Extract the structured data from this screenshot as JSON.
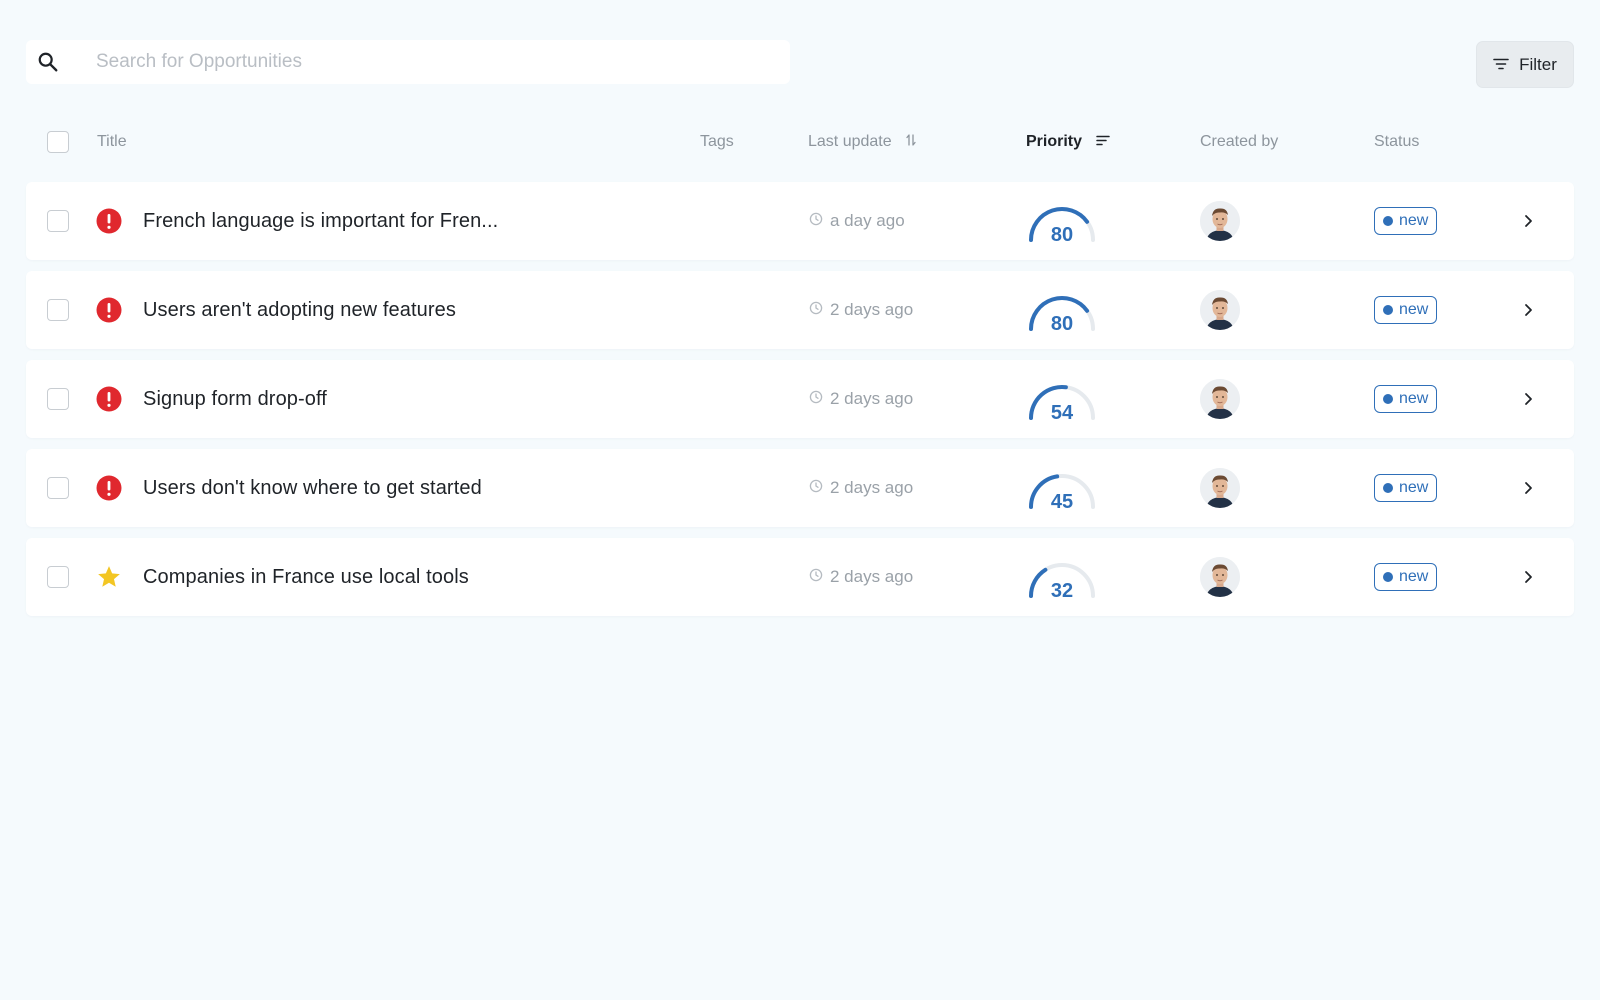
{
  "search": {
    "placeholder": "Search for Opportunities",
    "value": ""
  },
  "filter": {
    "label": "Filter"
  },
  "columns": {
    "title": "Title",
    "tags": "Tags",
    "last_update": "Last update",
    "priority": "Priority",
    "created_by": "Created by",
    "status": "Status"
  },
  "colors": {
    "accent": "#2f6fb8",
    "alert_red": "#e0282e",
    "star_yellow": "#f3c623",
    "background": "#f5fafd"
  },
  "rows": [
    {
      "icon": "alert-icon",
      "title": "French language is important for Fren...",
      "tags": "",
      "last_update": "a day ago",
      "priority": 80,
      "status": "new"
    },
    {
      "icon": "alert-icon",
      "title": "Users aren't adopting new features",
      "tags": "",
      "last_update": "2 days ago",
      "priority": 80,
      "status": "new"
    },
    {
      "icon": "alert-icon",
      "title": "Signup form drop-off",
      "tags": "",
      "last_update": "2 days ago",
      "priority": 54,
      "status": "new"
    },
    {
      "icon": "alert-icon",
      "title": "Users don't know where to get started",
      "tags": "",
      "last_update": "2 days ago",
      "priority": 45,
      "status": "new"
    },
    {
      "icon": "star-icon",
      "title": "Companies in France use local tools",
      "tags": "",
      "last_update": "2 days ago",
      "priority": 32,
      "status": "new"
    }
  ]
}
